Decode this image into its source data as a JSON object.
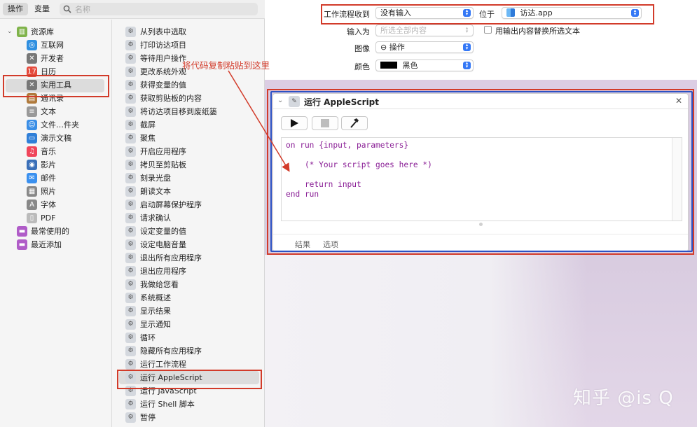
{
  "toolbar": {
    "tab_actions": "操作",
    "tab_variables": "变量",
    "search_placeholder": "名称"
  },
  "library": [
    {
      "label": "资源库",
      "icon": "library-icon",
      "color": "#7fb34a",
      "indent": 0,
      "chevron": true
    },
    {
      "label": "互联网",
      "icon": "globe-icon",
      "color": "#2f8fe0",
      "indent": 1
    },
    {
      "label": "开发者",
      "icon": "tools-icon",
      "color": "#777777",
      "indent": 1
    },
    {
      "label": "日历",
      "icon": "calendar-icon",
      "color": "#e54a3c",
      "indent": 1
    },
    {
      "label": "实用工具",
      "icon": "tools-icon",
      "color": "#777777",
      "indent": 1
    },
    {
      "label": "通讯录",
      "icon": "contacts-icon",
      "color": "#b07a3c",
      "indent": 1
    },
    {
      "label": "文本",
      "icon": "text-icon",
      "color": "#999999",
      "indent": 1
    },
    {
      "label": "文件…件夹",
      "icon": "finder-icon",
      "color": "#3a8ee6",
      "indent": 1
    },
    {
      "label": "演示文稿",
      "icon": "keynote-icon",
      "color": "#2f7fd8",
      "indent": 1
    },
    {
      "label": "音乐",
      "icon": "music-icon",
      "color": "#f0455a",
      "indent": 1
    },
    {
      "label": "影片",
      "icon": "movie-icon",
      "color": "#3a6fb8",
      "indent": 1
    },
    {
      "label": "邮件",
      "icon": "mail-icon",
      "color": "#3a90ef",
      "indent": 1
    },
    {
      "label": "照片",
      "icon": "photo-icon",
      "color": "#888888",
      "indent": 1
    },
    {
      "label": "字体",
      "icon": "font-icon",
      "color": "#888888",
      "indent": 1
    },
    {
      "label": "PDF",
      "icon": "pdf-icon",
      "color": "#bbbbbb",
      "indent": 1
    },
    {
      "label": "最常使用的",
      "icon": "smart-folder-icon",
      "color": "#b05cc8",
      "indent": 0
    },
    {
      "label": "最近添加",
      "icon": "smart-folder-icon",
      "color": "#b05cc8",
      "indent": 0
    }
  ],
  "actions": [
    "从列表中选取",
    "打印访达项目",
    "等待用户操作",
    "更改系统外观",
    "获得变量的值",
    "获取剪贴板的内容",
    "将访达项目移到废纸篓",
    "截屏",
    "聚焦",
    "开启应用程序",
    "拷贝至剪贴板",
    "刻录光盘",
    "朗读文本",
    "启动屏幕保护程序",
    "请求确认",
    "设定变量的值",
    "设定电脑音量",
    "退出所有应用程序",
    "退出应用程序",
    "我做给您看",
    "系统概述",
    "显示结果",
    "显示通知",
    "循环",
    "隐藏所有应用程序",
    "运行工作流程",
    "运行 AppleScript",
    "运行 JavaScript",
    "运行 Shell 脚本",
    "暂停"
  ],
  "header": {
    "workflow_receives_label": "工作流程收到",
    "workflow_receives_value": "没有输入",
    "in_label": "位于",
    "in_value": "访达.app",
    "input_is_label": "输入为",
    "input_is_value": "所选全部内容",
    "replace_checkbox_label": "用输出内容替换所选文本",
    "image_label": "图像",
    "image_value": "⊖ 操作",
    "color_label": "颜色",
    "color_value": "黑色",
    "color_swatch": "#000000"
  },
  "card": {
    "title": "运行 AppleScript",
    "code": "on run {input, parameters}\n\n    (* Your script goes here *)\n\n    return input\nend run",
    "tab_results": "结果",
    "tab_options": "选项"
  },
  "annotation": {
    "text": "将代码复制粘贴到这里",
    "color": "#d23b2a"
  },
  "watermark": "知乎 @is Q"
}
